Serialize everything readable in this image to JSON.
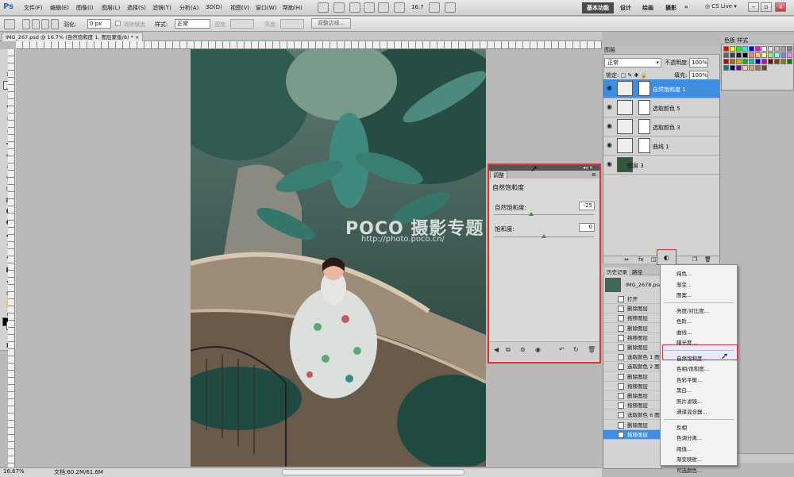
{
  "app": {
    "logo": "Ps"
  },
  "menubar": {
    "items": [
      "文件(F)",
      "编辑(E)",
      "图像(I)",
      "图层(L)",
      "选择(S)",
      "滤镜(T)",
      "分析(A)",
      "3D(D)",
      "视图(V)",
      "窗口(W)",
      "帮助(H)"
    ],
    "zoom_value": "16.7",
    "workspace_active": "基本功能",
    "workspaces": [
      "设计",
      "绘画",
      "摄影"
    ],
    "cslive": "CS Live"
  },
  "options": {
    "feather_label": "羽化:",
    "feather_value": "0 px",
    "antialias_label": "消除锯齿",
    "style_label": "样式:",
    "style_value": "正常",
    "width_label": "宽度:",
    "height_label": "高度:",
    "refine_button": "调整边缘..."
  },
  "document": {
    "tab_title": "IMG_267.psd @ 16.7% (自然饱和度 1, 图层蒙版/8) *"
  },
  "watermark": {
    "brand": "POCO 摄影专题",
    "url": "http://photo.poco.cn/"
  },
  "status": {
    "zoom": "16.67%",
    "doc_size": "文档:60.2M/61.6M"
  },
  "adjustments": {
    "tab": "调整",
    "title": "自然饱和度",
    "vibrance_label": "自然饱和度:",
    "vibrance_value": "-25",
    "vibrance_level": -25,
    "saturation_label": "饱和度:",
    "saturation_value": "0",
    "saturation_level": 0
  },
  "layers": {
    "tab": "图层",
    "blend_mode": "正常",
    "opacity_label": "不透明度:",
    "opacity_value": "100%",
    "lock_label": "锁定:",
    "fill_label": "填充:",
    "fill_value": "100%",
    "items": [
      {
        "name": "自然饱和度 1",
        "selected": true
      },
      {
        "name": "选取颜色 5"
      },
      {
        "name": "选取颜色 3"
      },
      {
        "name": "曲线 1"
      },
      {
        "name": "图层 3"
      }
    ]
  },
  "swatches": {
    "tab": "样式",
    "colors": [
      "#ff0000",
      "#ffff00",
      "#00ff00",
      "#00ffff",
      "#0000ff",
      "#ff00ff",
      "#ffffff",
      "#e0e0e0",
      "#c0c0c0",
      "#a0a0a0",
      "#808080",
      "#606060",
      "#404040",
      "#202020",
      "#000000",
      "#ff8080",
      "#ffc080",
      "#ffff80",
      "#80ff80",
      "#80ffff",
      "#8080ff",
      "#ff80ff",
      "#c00000",
      "#c06000",
      "#c0c000",
      "#00c000",
      "#00c0c0",
      "#0000c0",
      "#c000c0",
      "#800000",
      "#804000",
      "#808000",
      "#008000",
      "#008080",
      "#000080",
      "#800080",
      "#f0d0b0",
      "#d0a080",
      "#a07050",
      "#704020"
    ]
  },
  "history": {
    "tabs": [
      "历史记录",
      "路径"
    ],
    "snapshot": "IMG_2678.psd",
    "items": [
      {
        "label": "打开"
      },
      {
        "label": "删除图层"
      },
      {
        "label": "拖移图层"
      },
      {
        "label": "删除图层"
      },
      {
        "label": "拖移图层"
      },
      {
        "label": "删除图层"
      },
      {
        "label": "选取颜色 1 图层"
      },
      {
        "label": "选取颜色 2 图层"
      },
      {
        "label": "删除图层"
      },
      {
        "label": "拖移图层"
      },
      {
        "label": "删除图层"
      },
      {
        "label": "拖移图层"
      },
      {
        "label": "选取颜色 6 图层"
      },
      {
        "label": "删除图层"
      },
      {
        "label": "拖移图层",
        "selected": true
      }
    ]
  },
  "context_menu": {
    "groups": [
      [
        "纯色...",
        "渐变...",
        "图案..."
      ],
      [
        "亮度/对比度...",
        "色阶...",
        "曲线...",
        "曝光度..."
      ],
      [
        "自然饱和度...",
        "色相/饱和度...",
        "色彩平衡...",
        "黑白...",
        "照片滤镜...",
        "通道混合器..."
      ],
      [
        "反相",
        "色调分离...",
        "阈值...",
        "渐变映射...",
        "可选颜色..."
      ]
    ],
    "highlighted": "自然饱和度..."
  }
}
